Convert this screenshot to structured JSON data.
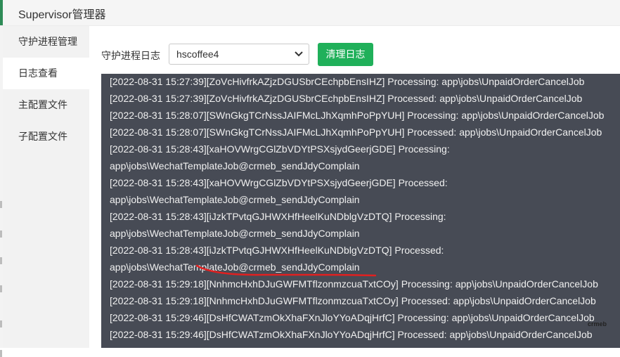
{
  "app": {
    "title": "Supervisor管理器"
  },
  "sidebar": {
    "items": [
      {
        "label": "守护进程管理"
      },
      {
        "label": "日志查看"
      },
      {
        "label": "主配置文件"
      },
      {
        "label": "子配置文件"
      }
    ]
  },
  "main": {
    "log_label": "守护进程日志",
    "selected_process": "hscoffee4",
    "clear_button": "清理日志",
    "log_lines": [
      "[2022-08-31 15:27:39][ZoVcHivfrkAZjzDGUSbrCEchpbEnsIHZ] Processing: app\\jobs\\UnpaidOrderCancelJob",
      "[2022-08-31 15:27:39][ZoVcHivfrkAZjzDGUSbrCEchpbEnsIHZ] Processed:  app\\jobs\\UnpaidOrderCancelJob",
      "[2022-08-31 15:28:07][SWnGkgTCrNssJAIFMcLJhXqmhPoPpYUH] Processing: app\\jobs\\UnpaidOrderCancelJob",
      "[2022-08-31 15:28:07][SWnGkgTCrNssJAIFMcLJhXqmhPoPpYUH] Processed:  app\\jobs\\UnpaidOrderCancelJob",
      "[2022-08-31 15:28:43][xaHOVWrgCGlZbVDYtPSXsjydGeerjGDE] Processing:",
      "app\\jobs\\WechatTemplateJob@crmeb_sendJdyComplain",
      "[2022-08-31 15:28:43][xaHOVWrgCGlZbVDYtPSXsjydGeerjGDE] Processed:",
      "app\\jobs\\WechatTemplateJob@crmeb_sendJdyComplain",
      "[2022-08-31 15:28:43][iJzkTPvtqGJHWXHfHeelKuNDblgVzDTQ] Processing:",
      "app\\jobs\\WechatTemplateJob@crmeb_sendJdyComplain",
      "[2022-08-31 15:28:43][iJzkTPvtqGJHWXHfHeelKuNDblgVzDTQ] Processed:",
      "app\\jobs\\WechatTemplateJob@crmeb_sendJdyComplain",
      "[2022-08-31 15:29:18][NnhmcHxhDJuGWFMTflzonmzcuaTxtCOy] Processing: app\\jobs\\UnpaidOrderCancelJob",
      "[2022-08-31 15:29:18][NnhmcHxhDJuGWFMTflzonmzcuaTxtCOy] Processed:  app\\jobs\\UnpaidOrderCancelJob",
      "[2022-08-31 15:29:46][DsHfCWATzmOkXhaFXnJloYYoADqjHrfC] Processing: app\\jobs\\UnpaidOrderCancelJob",
      "[2022-08-31 15:29:46][DsHfCWATzmOkXhaFXnJloYYoADqjHrfC] Processed:  app\\jobs\\UnpaidOrderCancelJob"
    ]
  },
  "watermark": "crmeb",
  "colors": {
    "accent_button": "#20b05a",
    "log_background": "#474b55",
    "annotation": "#e02020"
  },
  "icons": {
    "select_arrow": "chevron-down-icon"
  }
}
